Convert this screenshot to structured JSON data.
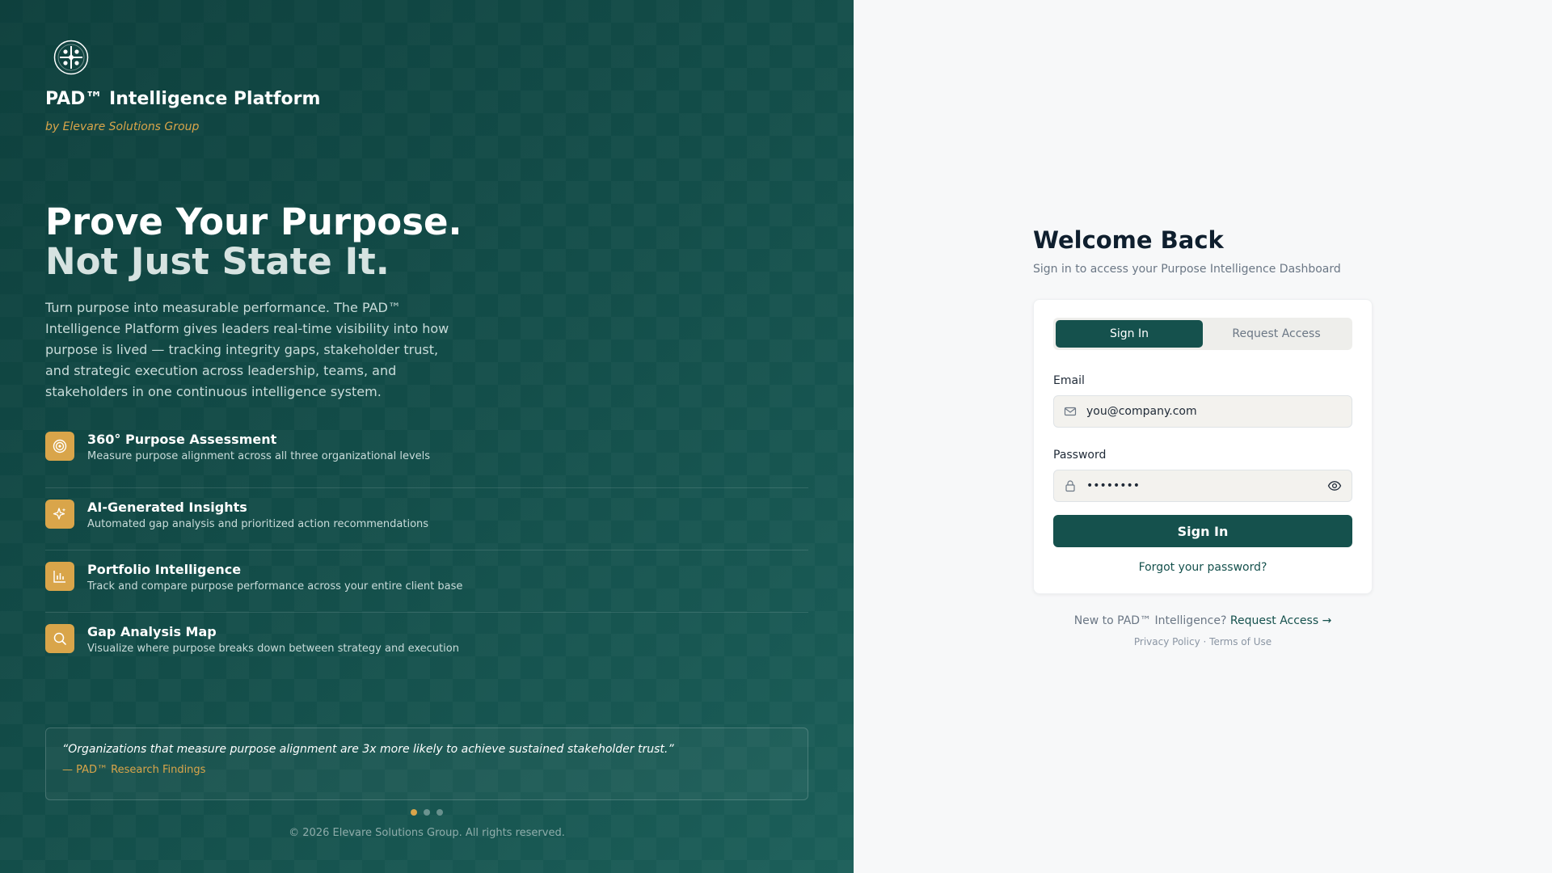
{
  "brand": {
    "title": "PAD™ Intelligence Platform",
    "subtitle": "by Elevare Solutions Group"
  },
  "hero": {
    "line1": "Prove Your Purpose.",
    "line2": "Not Just State It.",
    "intro": "Turn purpose into measurable performance. The PAD™ Intelligence Platform gives leaders real-time visibility into how purpose is lived — tracking integrity gaps, stakeholder trust, and strategic execution across leadership, teams, and stakeholders in one continuous intelligence system."
  },
  "features": [
    {
      "icon": "target-icon",
      "title": "360° Purpose Assessment",
      "desc": "Measure purpose alignment across all three organizational levels"
    },
    {
      "icon": "sparkle-icon",
      "title": "AI-Generated Insights",
      "desc": "Automated gap analysis and prioritized action recommendations"
    },
    {
      "icon": "bar-chart-icon",
      "title": "Portfolio Intelligence",
      "desc": "Track and compare purpose performance across your entire client base"
    },
    {
      "icon": "search-icon",
      "title": "Gap Analysis Map",
      "desc": "Visualize where purpose breaks down between strategy and execution"
    }
  ],
  "quote": {
    "text": "“Organizations that measure purpose alignment are 3x more likely to achieve sustained stakeholder trust.”",
    "source": "— PAD™ Research Findings"
  },
  "carousel": {
    "total": 3,
    "active": 1
  },
  "footer": {
    "copyright": "© 2026 Elevare Solutions Group. All rights reserved."
  },
  "login": {
    "heading": "Welcome Back",
    "subheading": "Sign in to access your Purpose Intelligence Dashboard",
    "tabs": [
      {
        "label": "Sign In",
        "active": true
      },
      {
        "label": "Request Access",
        "active": false
      }
    ],
    "email_label": "Email",
    "email_placeholder": "you@company.com",
    "password_label": "Password",
    "password_value": "••••••••",
    "submit_label": "Sign In",
    "forgot_label": "Forgot your password?",
    "new_to_text": "New to PAD™ Intelligence?",
    "request_link": "Request Access →",
    "privacy": "Privacy Policy",
    "separator": "·",
    "terms": "Terms of Use"
  },
  "colors": {
    "panel": "#15514d",
    "accent": "#d9a54a",
    "primary_button": "#15514d"
  }
}
